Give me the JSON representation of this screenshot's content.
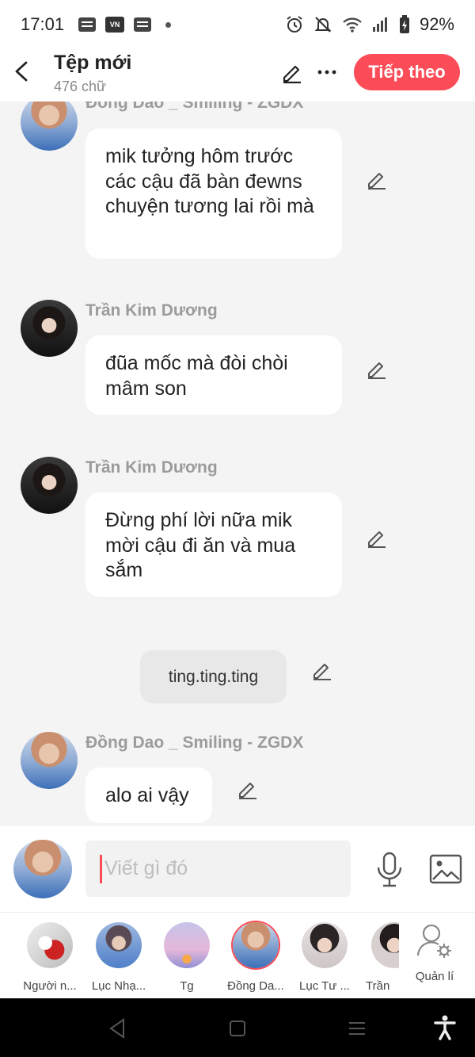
{
  "status_bar": {
    "time": "17:01",
    "battery": "92%",
    "icons": [
      "notification-icon",
      "vn-app-icon",
      "notification-icon",
      "dot-icon",
      "alarm-icon",
      "mute-icon",
      "wifi-icon",
      "signal-icon",
      "battery-charging-icon"
    ]
  },
  "header": {
    "title": "Tệp mới",
    "word_count": "476 chữ",
    "next_label": "Tiếp theo",
    "accent_color": "#fb4c58"
  },
  "messages": [
    {
      "sender": "Đồng Dao _ Smiling - ZGDX",
      "text": "mik tưởng hôm trước các cậu đã bàn đewns chuyện tương lai rồi mà"
    },
    {
      "sender": "Trần Kim Dương",
      "text": "đũa mốc mà đòi chòi mâm son"
    },
    {
      "sender": "Trần Kim Dương",
      "text": "Đừng phí lời nữa mik mời cậu đi ăn và mua sắm"
    },
    {
      "sender": "",
      "text": "ting.ting.ting"
    },
    {
      "sender": "Đồng Dao _ Smiling - ZGDX",
      "text": "alo ai vậy"
    }
  ],
  "composer": {
    "placeholder": "Viết gì đó"
  },
  "characters": [
    {
      "label": "Người n..."
    },
    {
      "label": "Lục Nhạ..."
    },
    {
      "label": "Tg"
    },
    {
      "label": "Đồng Da..."
    },
    {
      "label": "Lục Tư ..."
    },
    {
      "label": "Trần"
    }
  ],
  "manage_label": "Quản lí"
}
